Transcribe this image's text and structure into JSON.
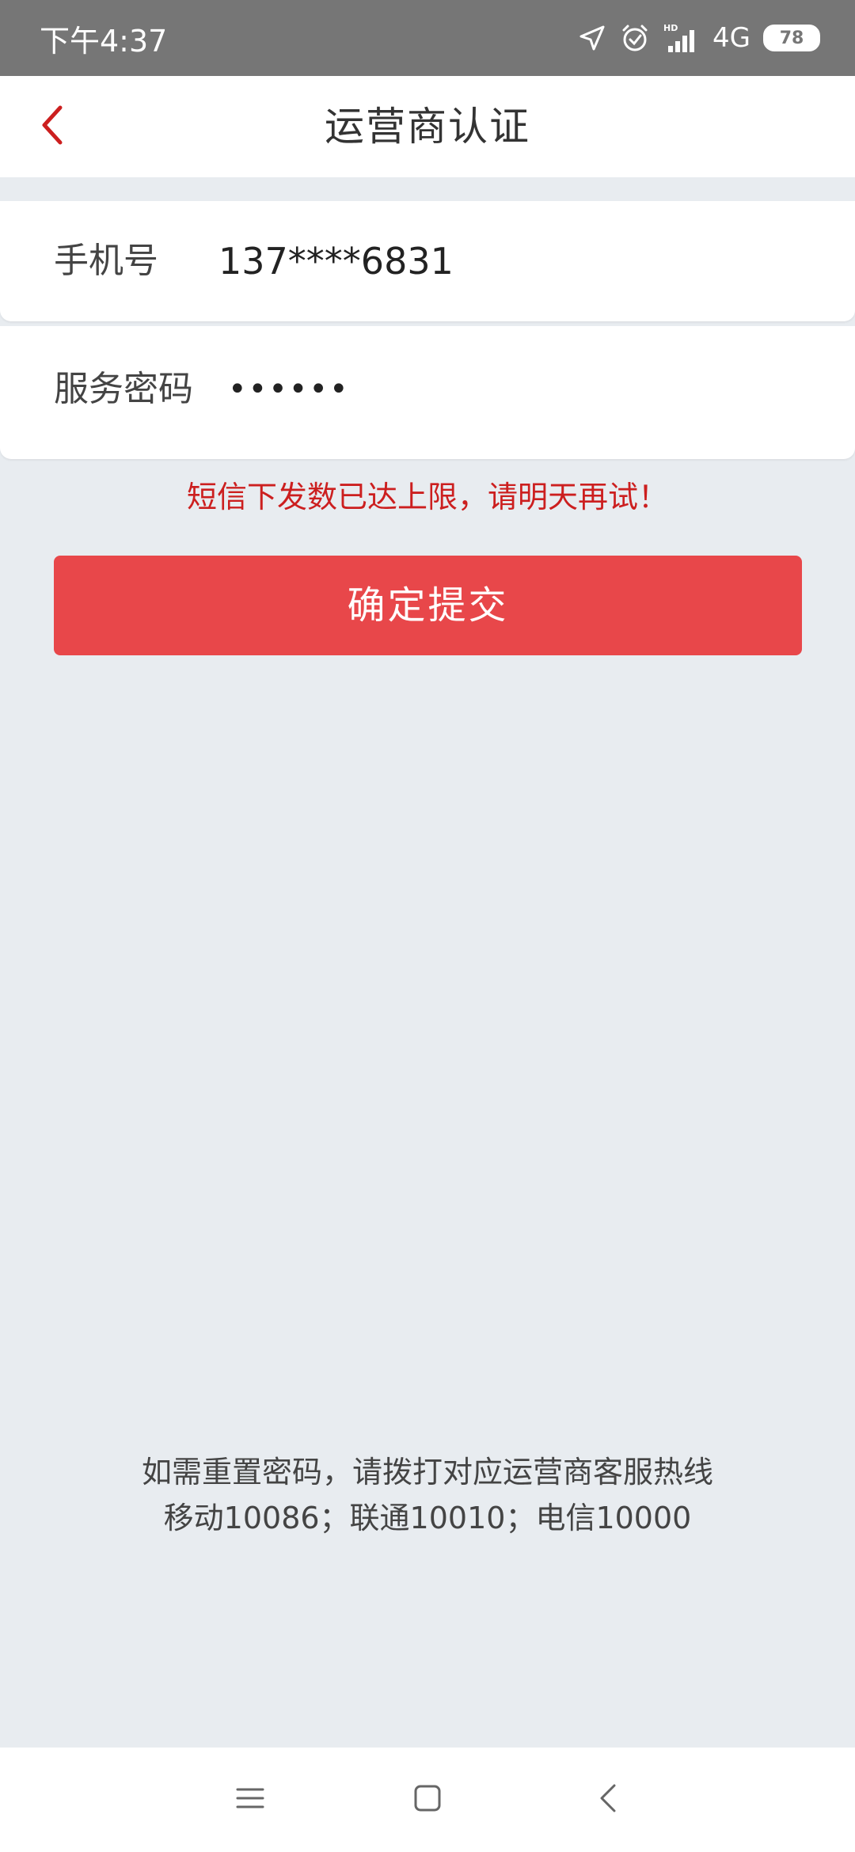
{
  "status_bar": {
    "time": "下午4:37",
    "network": "4G",
    "battery": "78",
    "icons": [
      "location-arrow-icon",
      "alarm-icon",
      "hd-signal-icon",
      "battery-icon"
    ]
  },
  "header": {
    "back_icon": "chevron-left-icon",
    "title": "运营商认证"
  },
  "form": {
    "phone_label": "手机号",
    "phone_value": "137****6831",
    "password_label": "服务密码",
    "password_value": "••••••"
  },
  "error_message": "短信下发数已达上限，请明天再试！",
  "submit_label": "确定提交",
  "help": {
    "line1": "如需重置密码，请拨打对应运营商客服热线",
    "line2": "移动10086；联通10010；电信10000"
  },
  "nav_bar": {
    "icons": [
      "menu-icon",
      "home-square-icon",
      "back-chevron-icon"
    ]
  },
  "colors": {
    "accent": "#e8474a",
    "error": "#cc1f1f",
    "back_arrow": "#cc1f1f",
    "background": "#e8ecf0",
    "status_bar": "#767676"
  }
}
